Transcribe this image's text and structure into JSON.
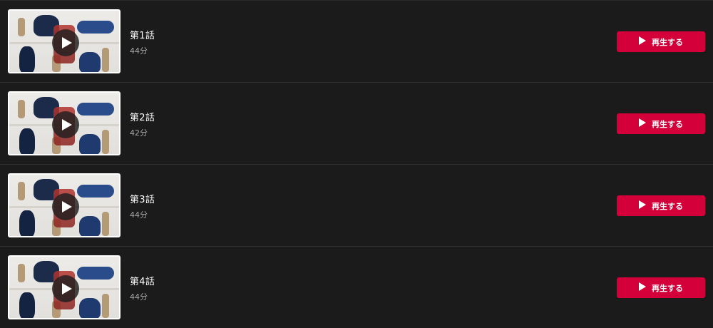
{
  "colors": {
    "background": "#1b1b1b",
    "accent": "#d4003a",
    "divider": "#303030",
    "duration_text": "#a8a8a8"
  },
  "episodes": [
    {
      "title": "第1話",
      "duration": "44分",
      "play_label": "再生する",
      "thumbnail_icon": "play-icon"
    },
    {
      "title": "第2話",
      "duration": "42分",
      "play_label": "再生する",
      "thumbnail_icon": "play-icon"
    },
    {
      "title": "第3話",
      "duration": "44分",
      "play_label": "再生する",
      "thumbnail_icon": "play-icon"
    },
    {
      "title": "第4話",
      "duration": "44分",
      "play_label": "再生する",
      "thumbnail_icon": "play-icon"
    }
  ]
}
